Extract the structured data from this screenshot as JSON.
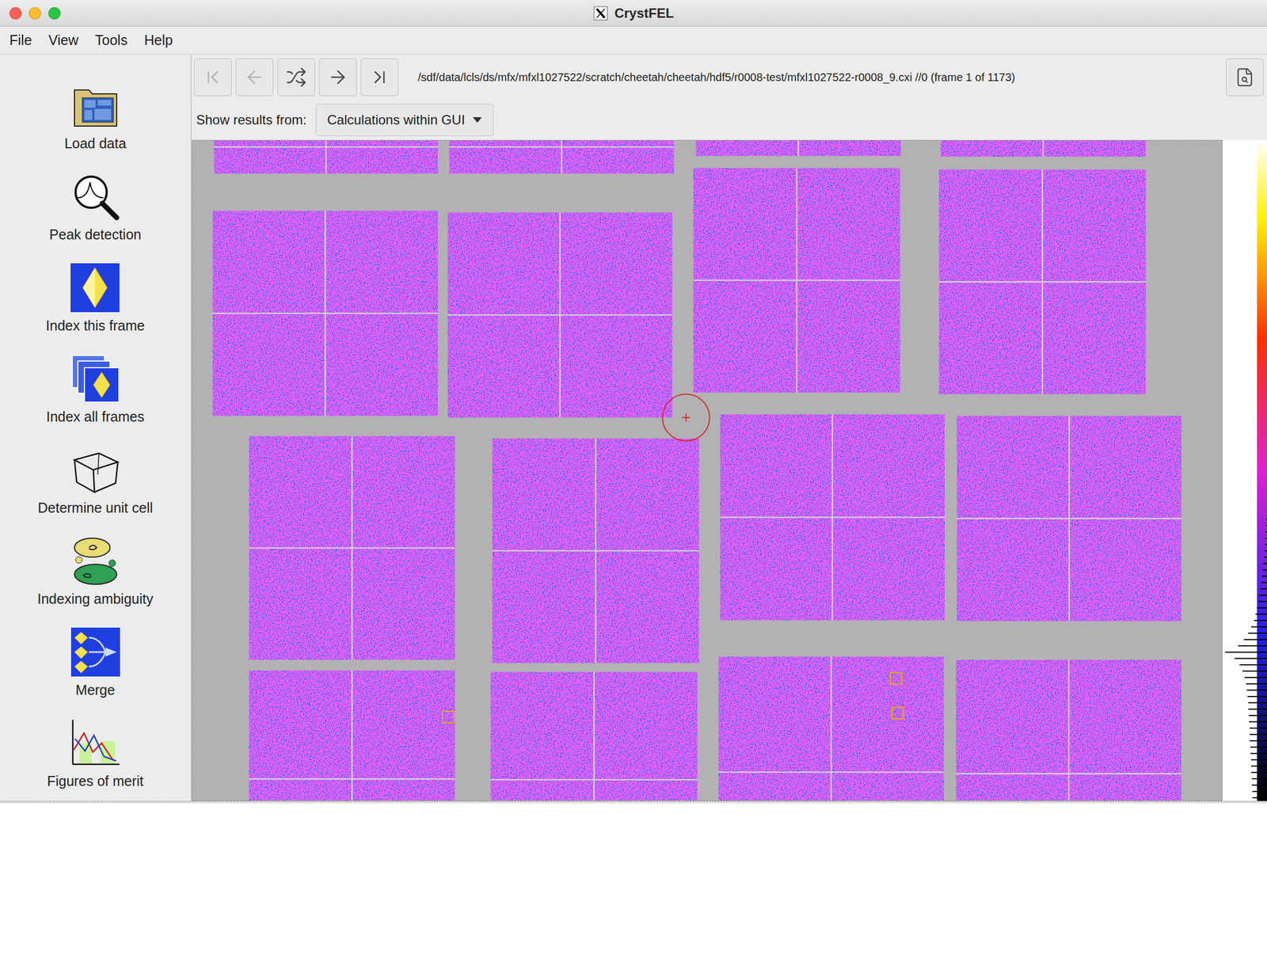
{
  "window": {
    "title": "CrystFEL"
  },
  "menu": [
    "File",
    "View",
    "Tools",
    "Help"
  ],
  "sidebar": {
    "items": [
      {
        "label": "Load data"
      },
      {
        "label": "Peak detection"
      },
      {
        "label": "Index this frame"
      },
      {
        "label": "Index all frames"
      },
      {
        "label": "Determine unit cell"
      },
      {
        "label": "Indexing ambiguity"
      },
      {
        "label": "Merge"
      },
      {
        "label": "Figures of merit"
      }
    ]
  },
  "navigation": {
    "buttons": [
      {
        "kind": "first",
        "disabled": true
      },
      {
        "kind": "previous",
        "disabled": true
      },
      {
        "kind": "random",
        "disabled": false
      },
      {
        "kind": "next",
        "disabled": false
      },
      {
        "kind": "last",
        "disabled": false
      }
    ]
  },
  "file_path": "/sdf/data/lcls/ds/mfx/mfxl1027522/scratch/cheetah/cheetah/hdf5/r0008-test/mfxl1027522-r0008_9.cxi //0 (frame 1 of 1173)",
  "results_source": {
    "label": "Show results from:",
    "value": "Calculations within GUI"
  },
  "colour_scale": {
    "histogram": [
      1,
      1,
      2,
      2,
      3,
      3,
      4,
      5,
      6,
      7,
      8,
      9,
      11,
      12,
      14,
      16,
      18,
      22,
      26,
      32,
      40,
      58,
      45,
      38,
      34,
      31,
      29,
      28,
      27,
      26,
      26,
      25,
      25,
      24,
      24,
      24,
      23,
      23,
      22,
      22,
      22,
      21,
      21,
      20,
      20
    ]
  }
}
